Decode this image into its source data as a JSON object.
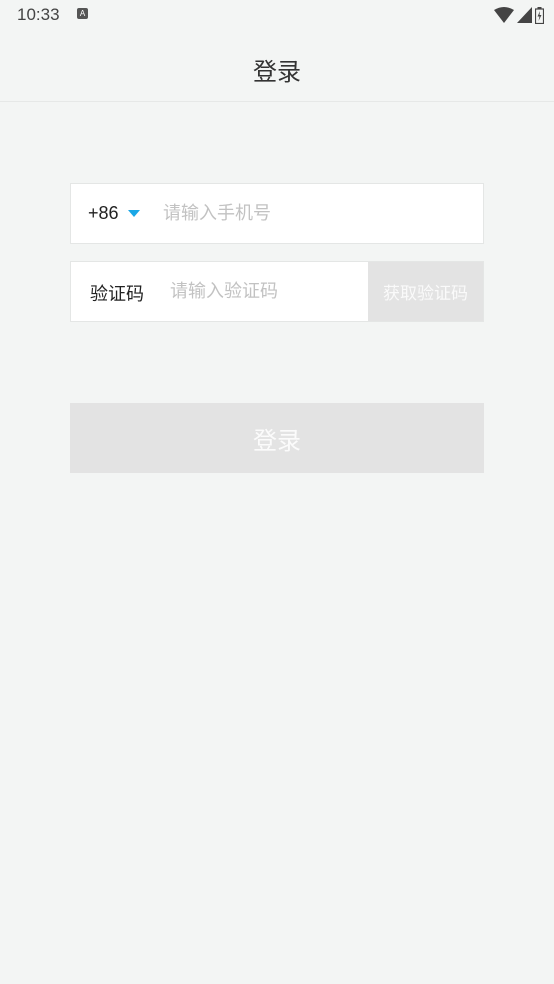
{
  "status_bar": {
    "time": "10:33",
    "notification_icon": "A"
  },
  "header": {
    "title": "登录"
  },
  "phone": {
    "country_code": "+86",
    "placeholder": "请输入手机号",
    "value": ""
  },
  "verification": {
    "label": "验证码",
    "placeholder": "请输入验证码",
    "value": "",
    "get_code_label": "获取验证码"
  },
  "login_button": {
    "label": "登录"
  },
  "colors": {
    "background": "#f3f5f4",
    "accent": "#1aa7e6",
    "disabled_button": "#e3e3e3"
  }
}
